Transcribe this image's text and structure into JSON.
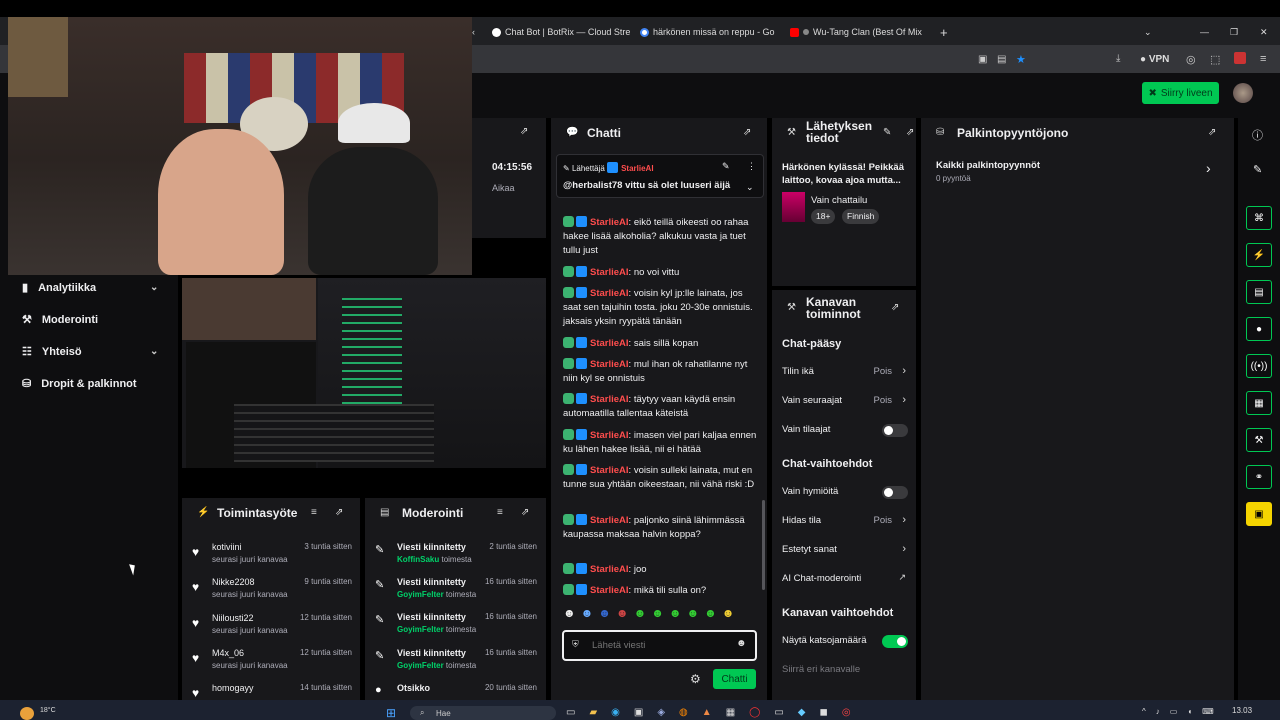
{
  "browser": {
    "tabs": [
      {
        "label": "Chat Bot | BotRix — Cloud Stre",
        "color": "#ffffff"
      },
      {
        "label": "härkönen missä on reppu - Go",
        "color": "#ffffff"
      },
      {
        "label": "Wu-Tang Clan (Best Of Mix",
        "color": "#ff0000"
      }
    ],
    "vpn_label": "VPN"
  },
  "header": {
    "go_live": "Siirry liveen"
  },
  "stream": {
    "uptime": "04:15:56",
    "uptime_label": "Aikaa"
  },
  "nav": {
    "items": [
      {
        "label": "Analytiikka",
        "icon": "analytics-icon"
      },
      {
        "label": "Moderointi",
        "icon": "wrench-icon"
      },
      {
        "label": "Yhteisö",
        "icon": "community-icon"
      },
      {
        "label": "Dropit & palkinnot",
        "icon": "drops-icon"
      }
    ]
  },
  "activity": {
    "title": "Toimintasyöte",
    "rows": [
      {
        "name": "kotiviini",
        "sub": "seurasi juuri kanavaa",
        "time": "3 tuntia sitten"
      },
      {
        "name": "Nikke2208",
        "sub": "seurasi juuri kanavaa",
        "time": "9 tuntia sitten"
      },
      {
        "name": "Niilousti22",
        "sub": "seurasi juuri kanavaa",
        "time": "12 tuntia sitten"
      },
      {
        "name": "M4x_06",
        "sub": "seurasi juuri kanavaa",
        "time": "12 tuntia sitten"
      },
      {
        "name": "homogayy",
        "sub": "",
        "time": "14 tuntia sitten"
      }
    ]
  },
  "moderation": {
    "title": "Moderointi",
    "rows": [
      {
        "name": "Viesti kiinnitetty",
        "user": "KoffinSaku",
        "action": "toimesta",
        "time": "2 tuntia sitten"
      },
      {
        "name": "Viesti kiinnitetty",
        "user": "GoyimFelter",
        "action": "toimesta",
        "time": "16 tuntia sitten"
      },
      {
        "name": "Viesti kiinnitetty",
        "user": "GoyimFelter",
        "action": "toimesta",
        "time": "16 tuntia sitten"
      },
      {
        "name": "Viesti kiinnitetty",
        "user": "GoyimFelter",
        "action": "toimesta",
        "time": "16 tuntia sitten"
      },
      {
        "name": "Otsikko",
        "user": "",
        "action": "",
        "time": "20 tuntia sitten"
      }
    ]
  },
  "chat": {
    "title": "Chatti",
    "pinned": {
      "label": "Lähettäjä",
      "user": "StarlieAI",
      "text": "@herbalist78 vittu sä olet luuseri äijä"
    },
    "messages": [
      {
        "user": "StarlieAI",
        "text": "eikö teillä oikeesti oo rahaa hakee lisää alkoholia? alkukuu vasta ja tuet tullu just"
      },
      {
        "user": "StarlieAI",
        "text": "no voi vittu"
      },
      {
        "user": "StarlieAI",
        "text": "voisin kyl jp:lle lainata, jos saat sen tajuihin tosta. joku 20-30e onnistuis. jaksais yksin ryypätä tänään"
      },
      {
        "user": "StarlieAI",
        "text": "sais sillä kopan"
      },
      {
        "user": "StarlieAI",
        "text": "mul ihan ok rahatilanne nyt niin kyl se onnistuis"
      },
      {
        "user": "StarlieAI",
        "text": "täytyy vaan käydä ensin automaatilla tallentaa käteistä"
      },
      {
        "user": "StarlieAI",
        "text": "imasen viel pari kaljaa ennen ku lähen hakee lisää, nii ei hätää"
      },
      {
        "user": "StarlieAI",
        "text": "voisin sulleki lainata, mut en tunne sua yhtään oikeestaan, nii vähä riski :D"
      },
      {
        "user": "StarlieAI",
        "text": "paljonko siinä lähimmässä kaupassa maksaa halvin koppa?"
      },
      {
        "user": "StarlieAI",
        "text": "joo"
      },
      {
        "user": "StarlieAI",
        "text": "mikä tili sulla on?"
      }
    ],
    "input_placeholder": "Lähetä viesti",
    "send_label": "Chatti"
  },
  "stream_info": {
    "title": "Lähetyksen tiedot",
    "stream_title": "Härkönen kylässä! Peikkää laittoo, kovaa ajoa mutta...",
    "category": "Vain chattailu",
    "tags": [
      "18+",
      "Finnish"
    ]
  },
  "rewards": {
    "title": "Palkintopyyntöjono",
    "all_label": "Kaikki palkintopyynnöt",
    "count_label": "0 pyyntöä"
  },
  "channel_actions": {
    "title": "Kanavan toiminnot",
    "chat_access": "Chat-pääsy",
    "account_age": {
      "label": "Tilin ikä",
      "value": "Pois"
    },
    "followers_only": {
      "label": "Vain seuraajat",
      "value": "Pois"
    },
    "subscribers_only": {
      "label": "Vain tilaajat",
      "on": false
    },
    "chat_options": "Chat-vaihtoehdot",
    "emotes_only": {
      "label": "Vain hymiöitä",
      "on": false
    },
    "slow_mode": {
      "label": "Hidas tila",
      "value": "Pois"
    },
    "blocked_words": "Estetyt sanat",
    "ai_moderation": "AI Chat-moderointi",
    "channel_options": "Kanavan vaihtoehdot",
    "show_viewers": {
      "label": "Näytä katsojamäärä",
      "on": true
    },
    "raid": "Siirrä eri kanavalle"
  },
  "taskbar": {
    "temp": "18°C",
    "search": "Hae",
    "time": "13.03"
  }
}
